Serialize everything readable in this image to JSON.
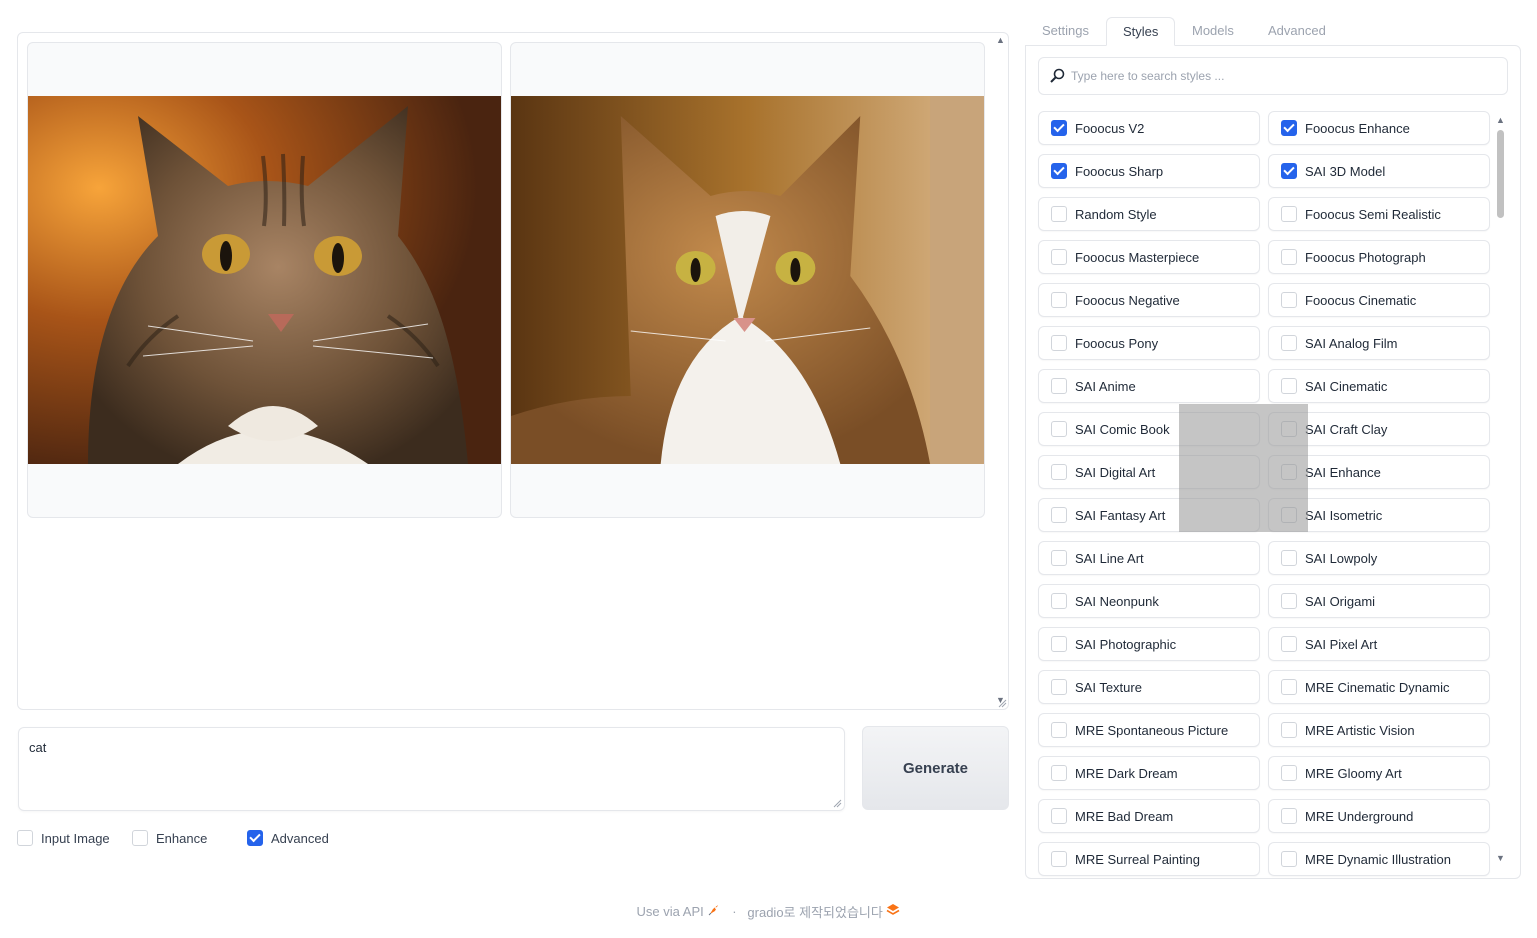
{
  "gallery": {
    "images": [
      {
        "alt": "tabby cat portrait"
      },
      {
        "alt": "calico cat portrait"
      }
    ]
  },
  "prompt": {
    "value": "cat"
  },
  "generate_label": "Generate",
  "options": [
    {
      "label": "Input Image",
      "checked": false
    },
    {
      "label": "Enhance",
      "checked": false
    },
    {
      "label": "Advanced",
      "checked": true
    }
  ],
  "tabs": [
    {
      "label": "Settings",
      "active": false
    },
    {
      "label": "Styles",
      "active": true
    },
    {
      "label": "Models",
      "active": false
    },
    {
      "label": "Advanced",
      "active": false
    }
  ],
  "search": {
    "placeholder": "Type here to search styles ..."
  },
  "styles": [
    {
      "label": "Fooocus V2",
      "checked": true
    },
    {
      "label": "Fooocus Enhance",
      "checked": true
    },
    {
      "label": "Fooocus Sharp",
      "checked": true
    },
    {
      "label": "SAI 3D Model",
      "checked": true
    },
    {
      "label": "Random Style",
      "checked": false
    },
    {
      "label": "Fooocus Semi Realistic",
      "checked": false
    },
    {
      "label": "Fooocus Masterpiece",
      "checked": false
    },
    {
      "label": "Fooocus Photograph",
      "checked": false
    },
    {
      "label": "Fooocus Negative",
      "checked": false
    },
    {
      "label": "Fooocus Cinematic",
      "checked": false
    },
    {
      "label": "Fooocus Pony",
      "checked": false
    },
    {
      "label": "SAI Analog Film",
      "checked": false
    },
    {
      "label": "SAI Anime",
      "checked": false
    },
    {
      "label": "SAI Cinematic",
      "checked": false
    },
    {
      "label": "SAI Comic Book",
      "checked": false
    },
    {
      "label": "SAI Craft Clay",
      "checked": false
    },
    {
      "label": "SAI Digital Art",
      "checked": false
    },
    {
      "label": "SAI Enhance",
      "checked": false
    },
    {
      "label": "SAI Fantasy Art",
      "checked": false
    },
    {
      "label": "SAI Isometric",
      "checked": false
    },
    {
      "label": "SAI Line Art",
      "checked": false
    },
    {
      "label": "SAI Lowpoly",
      "checked": false
    },
    {
      "label": "SAI Neonpunk",
      "checked": false
    },
    {
      "label": "SAI Origami",
      "checked": false
    },
    {
      "label": "SAI Photographic",
      "checked": false
    },
    {
      "label": "SAI Pixel Art",
      "checked": false
    },
    {
      "label": "SAI Texture",
      "checked": false
    },
    {
      "label": "MRE Cinematic Dynamic",
      "checked": false
    },
    {
      "label": "MRE Spontaneous Picture",
      "checked": false
    },
    {
      "label": "MRE Artistic Vision",
      "checked": false
    },
    {
      "label": "MRE Dark Dream",
      "checked": false
    },
    {
      "label": "MRE Gloomy Art",
      "checked": false
    },
    {
      "label": "MRE Bad Dream",
      "checked": false
    },
    {
      "label": "MRE Underground",
      "checked": false
    },
    {
      "label": "MRE Surreal Painting",
      "checked": false
    },
    {
      "label": "MRE Dynamic Illustration",
      "checked": false
    }
  ],
  "footer": {
    "api_label": "Use via API",
    "separator": "·",
    "built_with": "gradio로 제작되었습니다"
  },
  "colors": {
    "accent": "#2563eb",
    "border": "#e5e7eb",
    "muted_text": "#9ca3af"
  },
  "icons": [
    "rocket-icon",
    "gradio-logo-icon",
    "search-icon",
    "scroll-up-icon",
    "scroll-down-icon",
    "resize-grip-icon"
  ]
}
